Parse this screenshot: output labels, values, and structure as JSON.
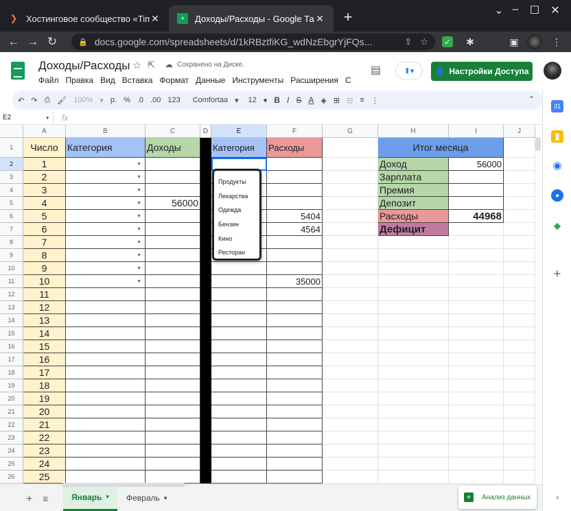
{
  "browser": {
    "tabs": [
      {
        "title": "Хостинговое сообщество «Timeweb»",
        "active": false
      },
      {
        "title": "Доходы/Расходы - Google Таблицы",
        "active": true
      }
    ],
    "url": "docs.google.com/spreadsheets/d/1kRBztfiKG_wdNzEbgrYjFQs..."
  },
  "sheets": {
    "title": "Доходы/Расходы",
    "save_status": "Сохранено на Диске.",
    "menu": [
      "Файл",
      "Правка",
      "Вид",
      "Вставка",
      "Формат",
      "Данные",
      "Инструменты",
      "Расширения",
      "С"
    ],
    "share_label": "Настройки Доступа",
    "toolbar": {
      "zoom": "100%",
      "currency": "р.",
      "percent": "%",
      "dec_decrease": ".0",
      "dec_increase": ".00",
      "format": "123",
      "font": "Comfortaa",
      "font_size": "12",
      "bold": "B",
      "italic": "I",
      "strike": "S",
      "textcolor": "A"
    },
    "namebox": "E2",
    "fx": "fx"
  },
  "grid": {
    "columns": [
      "A",
      "B",
      "C",
      "D",
      "E",
      "F",
      "G",
      "H",
      "I",
      "J"
    ],
    "selected_col": "E",
    "selected_row": 2,
    "rows": [
      "1",
      "2",
      "3",
      "4",
      "5",
      "6",
      "7",
      "8",
      "9",
      "10",
      "11",
      "12",
      "13",
      "14",
      "15",
      "16",
      "17",
      "18",
      "19",
      "20",
      "21",
      "22",
      "23",
      "24",
      "25",
      "26"
    ],
    "headers": {
      "a": "Число",
      "b": "Категория",
      "c": "Доходы",
      "e": "Категория",
      "f": "Расходы"
    },
    "numbers": [
      "1",
      "2",
      "3",
      "4",
      "5",
      "6",
      "7",
      "8",
      "9",
      "10",
      "11",
      "12",
      "13",
      "14",
      "15",
      "16",
      "17",
      "18",
      "19",
      "20",
      "21",
      "22",
      "23",
      "24",
      "25"
    ],
    "income_c5": "56000",
    "expenses": {
      "f6": "5404",
      "f7": "4564",
      "f11": "35000"
    },
    "summary": {
      "title": "Итог месяца",
      "income_label": "Доход",
      "income_value": "56000",
      "salary_label": "Зарплата",
      "bonus_label": "Премия",
      "deposit_label": "Депозит",
      "expense_label": "Расходы",
      "expense_value": "44968",
      "deficit_label": "Дефицит"
    },
    "colors": {
      "yellow": "#fff2cc",
      "blue": "#a4c2f4",
      "green": "#b6d7a8",
      "red": "#ea9999",
      "purple": "#c27ba0",
      "header_blue": "#6d9eeb"
    }
  },
  "dropdown": {
    "options": [
      "Продукты",
      "Лекарства",
      "Одежда",
      "Бензин",
      "Кино",
      "Ресторан"
    ]
  },
  "sheet_tabs": [
    "Январь",
    "Февраль"
  ],
  "explore_label": "Анализ данных"
}
